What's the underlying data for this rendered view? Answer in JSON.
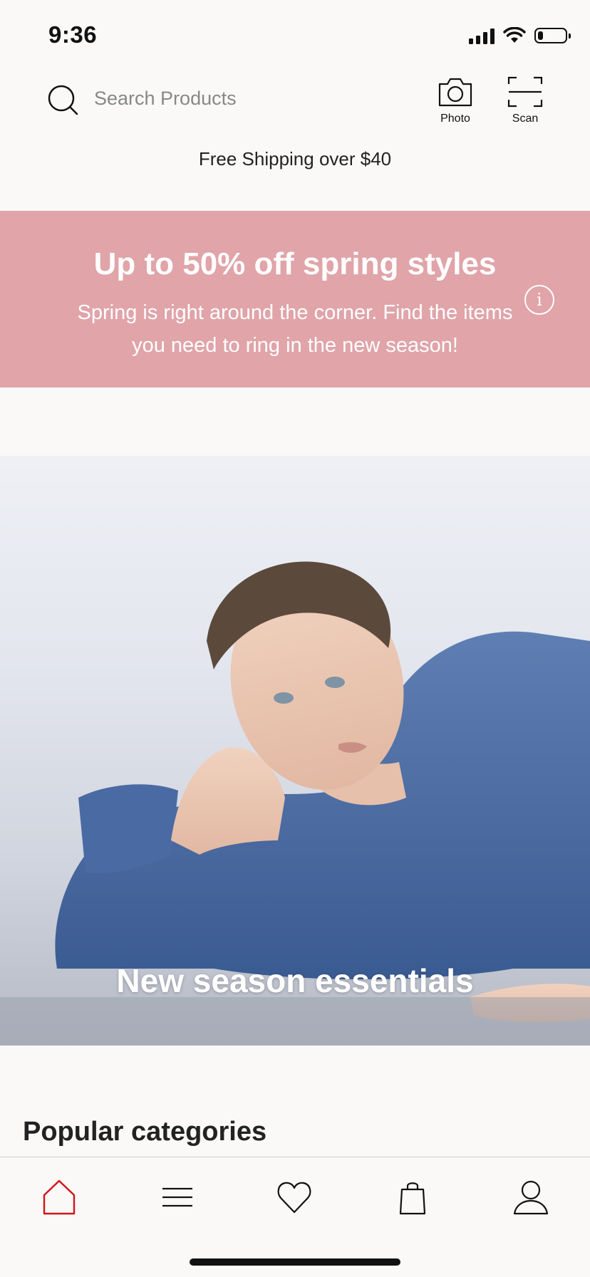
{
  "status_bar": {
    "time": "9:36",
    "battery_level": 0.2
  },
  "search": {
    "placeholder": "Search Products",
    "photo_label": "Photo",
    "scan_label": "Scan"
  },
  "shipping_banner": "Free Shipping over $40",
  "promo": {
    "title": "Up to 50% off spring styles",
    "body": "Spring is right around the corner. Find the items you need to ring in the new season!",
    "info_glyph": "i",
    "background": "#e0a4a9"
  },
  "hero": {
    "caption": "New season essentials"
  },
  "sections": {
    "popular_title": "Popular categories"
  },
  "tab_bar": {
    "items": [
      {
        "name": "home",
        "icon": "home-icon",
        "active": true
      },
      {
        "name": "menu",
        "icon": "menu-icon",
        "active": false
      },
      {
        "name": "favorites",
        "icon": "heart-icon",
        "active": false
      },
      {
        "name": "bag",
        "icon": "shopping-bag-icon",
        "active": false
      },
      {
        "name": "account",
        "icon": "user-icon",
        "active": false
      }
    ],
    "active_color": "#d0121b"
  }
}
